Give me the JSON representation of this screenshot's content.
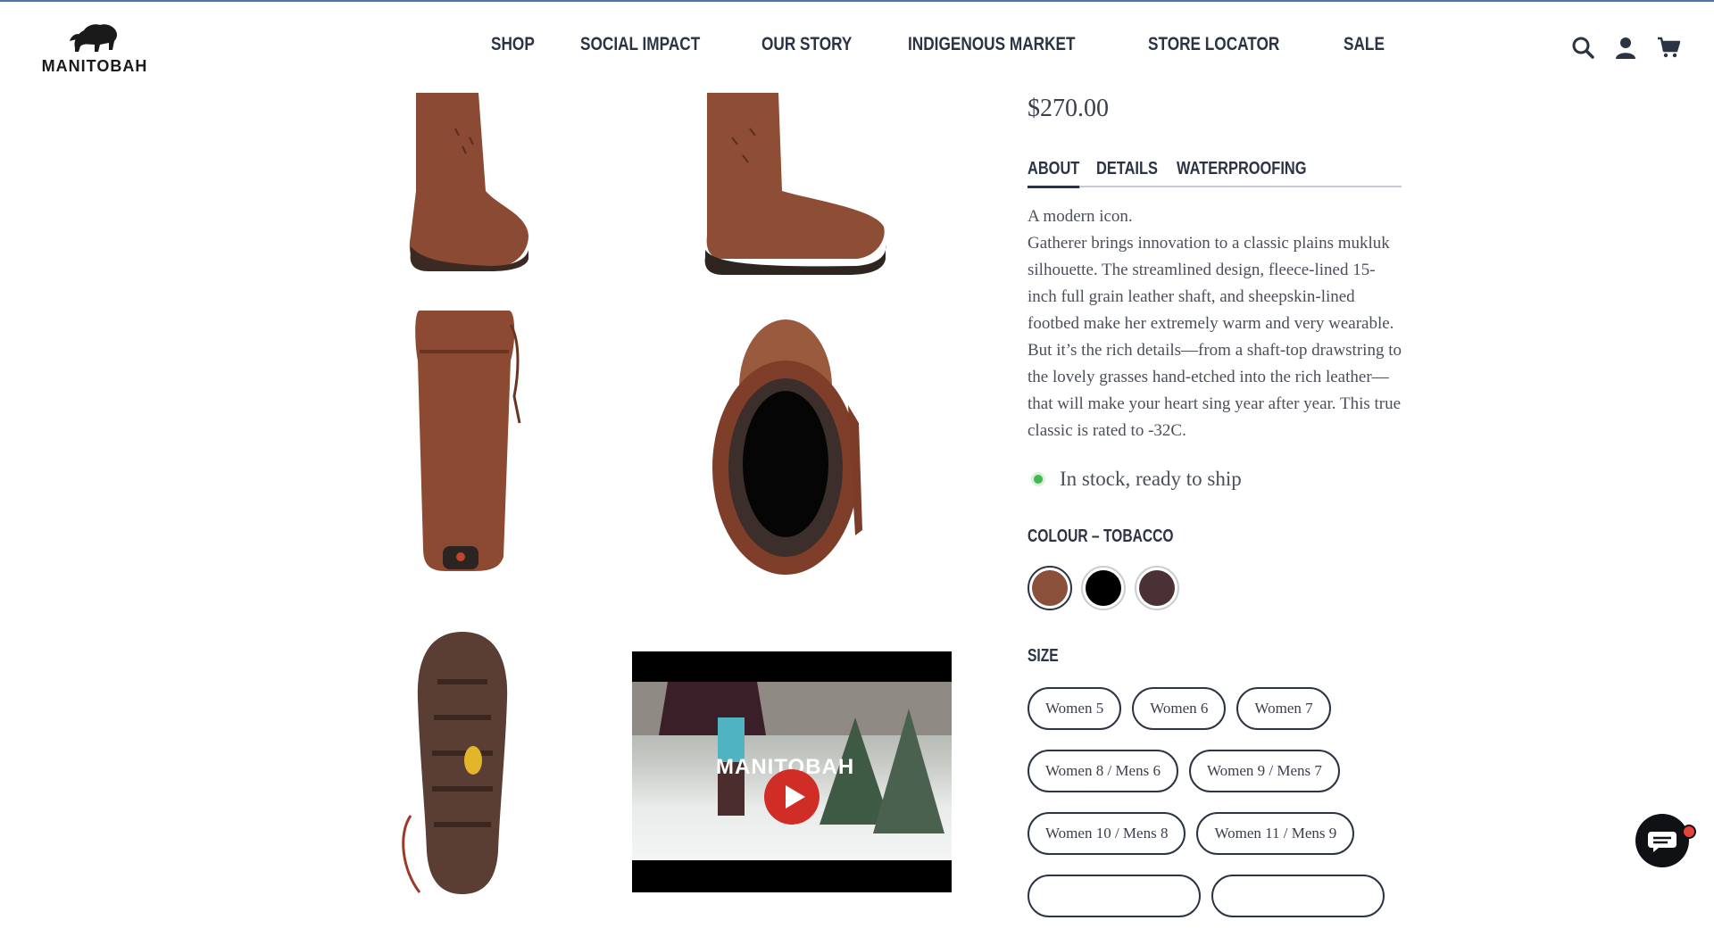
{
  "header": {
    "logo_text": "MANITOBAH",
    "nav": [
      "SHOP",
      "SOCIAL IMPACT",
      "OUR STORY",
      "INDIGENOUS MARKET",
      "STORE LOCATOR",
      "SALE"
    ]
  },
  "product": {
    "price": "$270.00",
    "tabs": [
      "ABOUT",
      "DETAILS",
      "WATERPROOFING"
    ],
    "active_tab": "ABOUT",
    "about_heading": "A modern icon.",
    "about_body": "Gatherer brings innovation to a classic plains mukluk silhouette. The streamlined design, fleece-lined 15-inch full grain leather shaft, and sheepskin-lined footbed make her extremely warm and very wearable. But it’s the rich details—from a shaft-top drawstring to the lovely grasses hand-etched into the rich leather—that will make your heart sing year after year. This true classic is rated to -32C.",
    "stock": "In stock, ready to ship",
    "colour_label": "COLOUR – TOBACCO",
    "colours": [
      {
        "name": "Tobacco",
        "hex": "#8a5039"
      },
      {
        "name": "Black",
        "hex": "#000000"
      },
      {
        "name": "Dark brown",
        "hex": "#4a3234"
      }
    ],
    "size_label": "SIZE",
    "sizes": [
      [
        "Women 5",
        "Women 6",
        "Women 7"
      ],
      [
        "Women 8 / Mens 6",
        "Women 9 / Mens 7"
      ],
      [
        "Women 10 / Mens 8",
        "Women 11 / Mens 9"
      ]
    ]
  },
  "video": {
    "brand": "MANITOBAH"
  },
  "colors": {
    "accent": "#2b3344",
    "stock_green": "#3fb950",
    "play_red": "#d12d27"
  }
}
